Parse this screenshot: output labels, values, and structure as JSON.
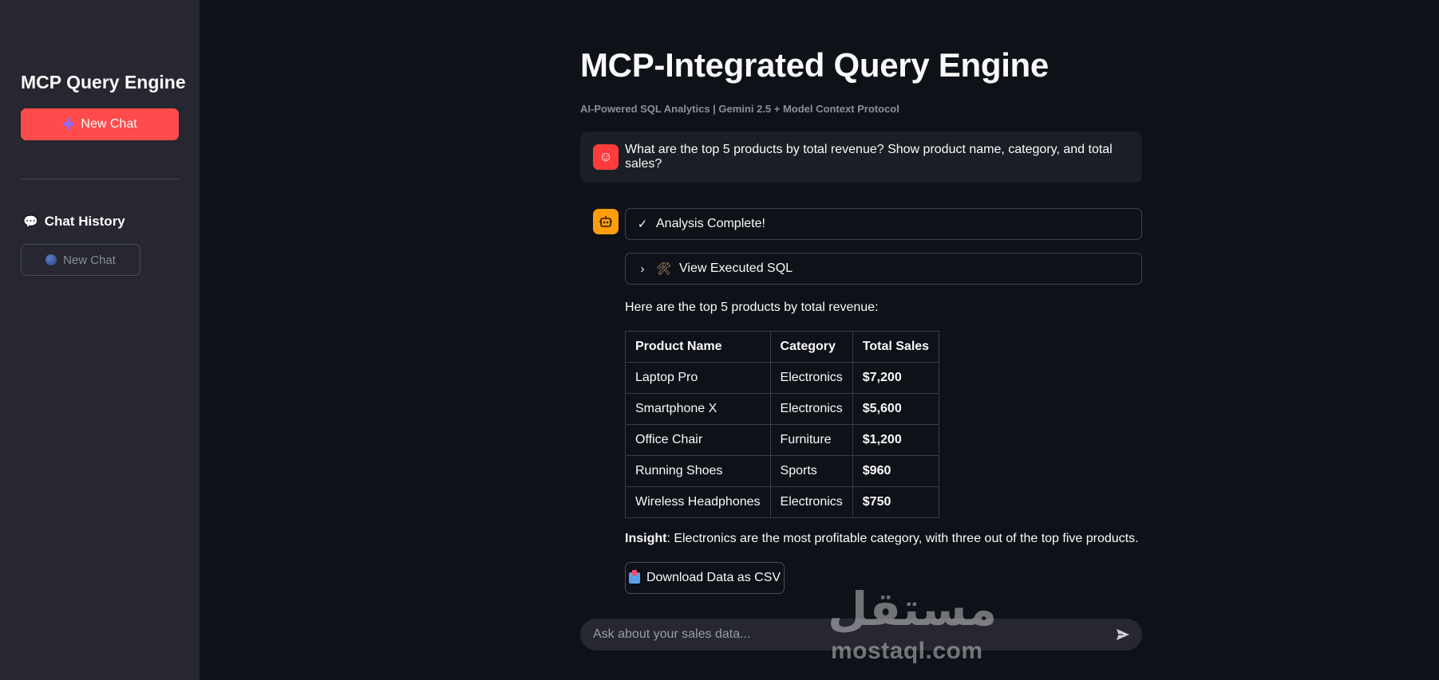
{
  "sidebar": {
    "title": "MCP Query Engine",
    "new_chat_label": "New Chat",
    "history_title": "Chat History",
    "history_items": [
      {
        "label": "New Chat"
      }
    ]
  },
  "header": {
    "title": "MCP-Integrated Query Engine",
    "subtitle": "AI-Powered SQL Analytics | Gemini 2.5 + Model Context Protocol"
  },
  "messages": {
    "user": {
      "text": "What are the top 5 products by total revenue? Show product name, category, and total sales?"
    },
    "assistant": {
      "status_label": "Analysis Complete!",
      "sql_expander_label": "View Executed SQL",
      "intro": "Here are the top 5 products by total revenue:",
      "table": {
        "headers": [
          "Product Name",
          "Category",
          "Total Sales"
        ],
        "rows": [
          [
            "Laptop Pro",
            "Electronics",
            "$7,200"
          ],
          [
            "Smartphone X",
            "Electronics",
            "$5,600"
          ],
          [
            "Office Chair",
            "Furniture",
            "$1,200"
          ],
          [
            "Running Shoes",
            "Sports",
            "$960"
          ],
          [
            "Wireless Headphones",
            "Electronics",
            "$750"
          ]
        ]
      },
      "insight_label": "Insight",
      "insight_text": ": Electronics are the most profitable category, with three out of the top five products.",
      "download_label": "Download Data as CSV"
    }
  },
  "input": {
    "placeholder": "Ask about your sales data..."
  },
  "watermark": {
    "arabic": "مستقل",
    "latin": "mostaql.com"
  },
  "colors": {
    "background": "#0e1117",
    "sidebar": "#262730",
    "accent": "#ff4b4b",
    "bot_avatar": "#ff9d0a"
  }
}
